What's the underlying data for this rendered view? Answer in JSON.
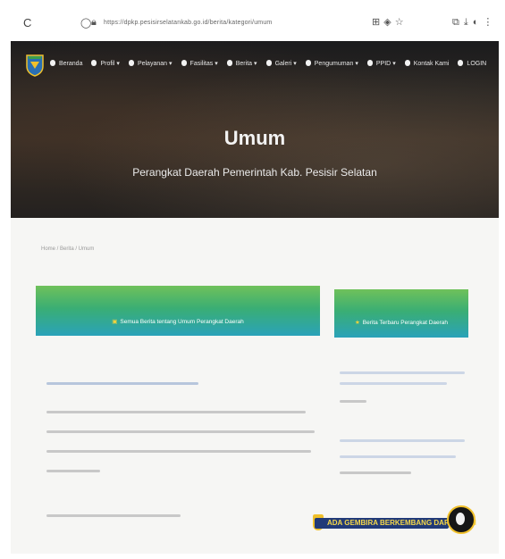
{
  "browser": {
    "back_icon": "back-arrow-icon",
    "reload_icon": "reload-icon",
    "url": "https://dpkp.pesisirselatankab.go.id/berita/kategori/umum",
    "toolbar_icons": [
      "grid-icon",
      "translate-icon",
      "star-icon"
    ],
    "extra_icons": [
      "extensions-icon",
      "download-icon",
      "profile-icon",
      "menu-icon"
    ]
  },
  "nav": {
    "items": [
      {
        "label": "Beranda"
      },
      {
        "label": "Profil",
        "caret": "▾"
      },
      {
        "label": "Pelayanan",
        "caret": "▾"
      },
      {
        "label": "Fasilitas",
        "caret": "▾"
      },
      {
        "label": "Berita",
        "caret": "▾"
      },
      {
        "label": "Galeri",
        "caret": "▾"
      },
      {
        "label": "Pengumuman",
        "caret": "▾"
      },
      {
        "label": "PPID",
        "caret": "▾"
      },
      {
        "label": "Kontak Kami"
      },
      {
        "label": "LOGIN"
      }
    ]
  },
  "hero": {
    "title": "Umum",
    "subtitle": "Perangkat Daerah Pemerintah Kab. Pesisir Selatan"
  },
  "breadcrumb": "Home / Berita / Umum",
  "cards": {
    "main_label": "Semua Berita tentang Umum Perangkat Daerah",
    "side_label": "Berita Terbaru Perangkat Daerah"
  },
  "colors": {
    "card_green": "#6fc15a",
    "card_teal": "#2aa2b9",
    "hero_dark": "#1b1b1d",
    "ad_blue": "#213a78",
    "ad_gold": "#f0c02b"
  },
  "ad": {
    "text": "ADA GEMBIRA BERKEMBANG DARI SIDATI"
  }
}
